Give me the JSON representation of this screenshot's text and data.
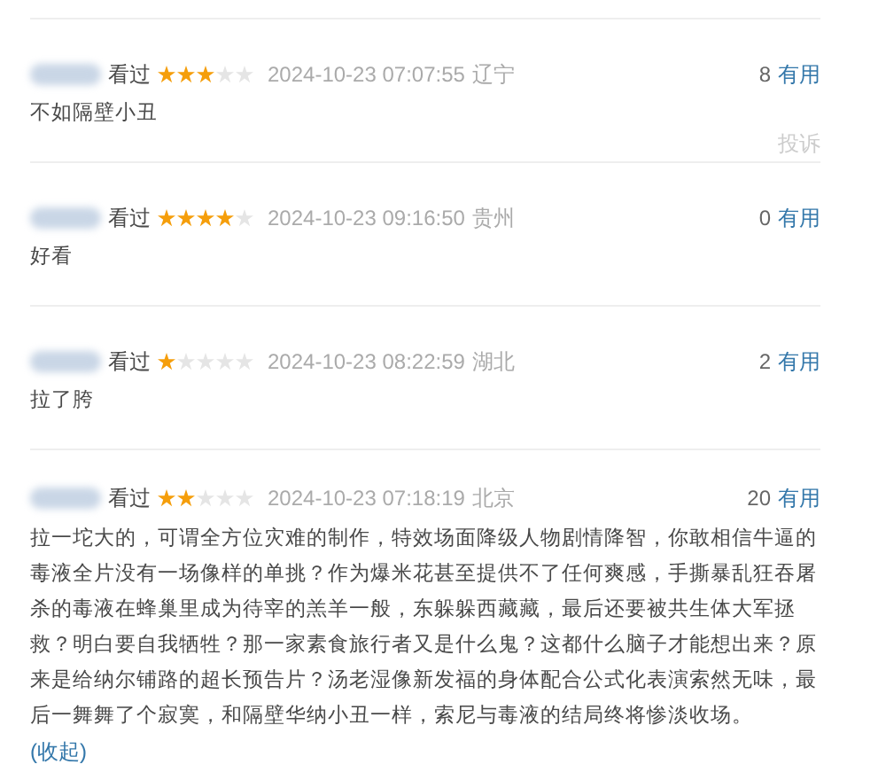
{
  "reviews": [
    {
      "status": "看过",
      "stars": 3,
      "time": "2024-10-23 07:07:55",
      "location": "辽宁",
      "votes": "8",
      "useful": "有用",
      "content": "不如隔壁小丑",
      "report": "投诉"
    },
    {
      "status": "看过",
      "stars": 4,
      "time": "2024-10-23 09:16:50",
      "location": "贵州",
      "votes": "0",
      "useful": "有用",
      "content": "好看"
    },
    {
      "status": "看过",
      "stars": 1,
      "time": "2024-10-23 08:22:59",
      "location": "湖北",
      "votes": "2",
      "useful": "有用",
      "content": "拉了胯"
    },
    {
      "status": "看过",
      "stars": 2,
      "time": "2024-10-23 07:18:19",
      "location": "北京",
      "votes": "20",
      "useful": "有用",
      "content": "拉一坨大的，可谓全方位灾难的制作，特效场面降级人物剧情降智，你敢相信牛逼的毒液全片没有一场像样的单挑？作为爆米花甚至提供不了任何爽感，手撕暴乱狂吞屠杀的毒液在蜂巢里成为待宰的羔羊一般，东躲躲西藏藏，最后还要被共生体大军拯救？明白要自我牺牲？那一家素食旅行者又是什么鬼？这都什么脑子才能想出来？原来是给纳尔铺路的超长预告片？汤老湿像新发福的身体配合公式化表演索然无味，最后一舞舞了个寂寞，和隔壁华纳小丑一样，索尼与毒液的结局终将惨淡收场。",
      "collapse": "(收起)"
    }
  ]
}
